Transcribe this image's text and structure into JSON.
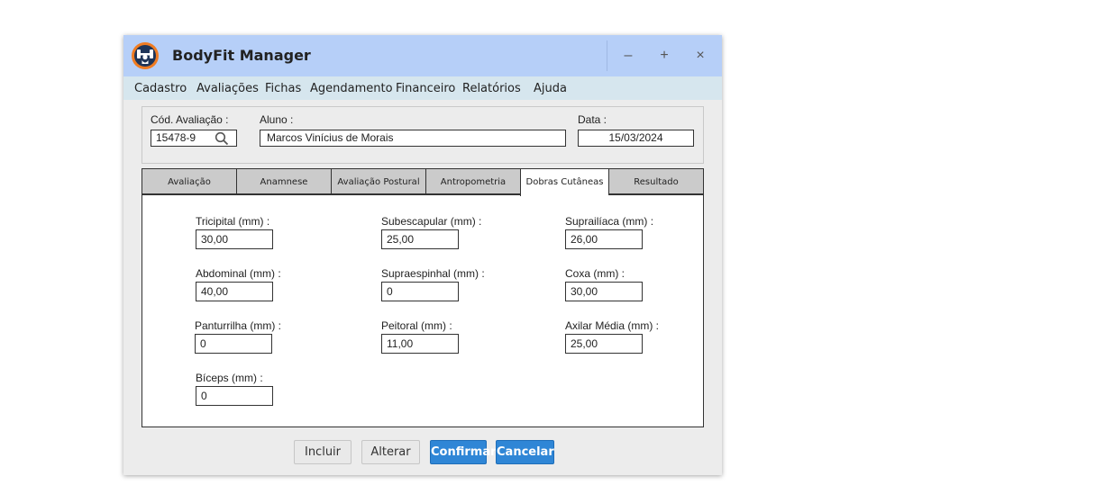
{
  "window": {
    "title": "BodyFit Manager",
    "controls": {
      "minimize": "–",
      "maximize": "+",
      "close": "×"
    }
  },
  "menu": [
    "Cadastro",
    "Avaliações",
    "Fichas",
    "Agendamento",
    "Financeiro",
    "Relatórios",
    "Ajuda"
  ],
  "header": {
    "cod_label": "Cód. Avaliação :",
    "cod_value": "15478-9",
    "aluno_label": "Aluno :",
    "aluno_value": "Marcos Vinícius de Morais",
    "data_label": "Data :",
    "data_value": "15/03/2024"
  },
  "tabs": [
    "Avaliação",
    "Anamnese",
    "Avaliação Postural",
    "Antropometria",
    "Dobras Cutâneas",
    "Resultado"
  ],
  "active_tab": "Dobras Cutâneas",
  "fields": [
    {
      "label": "Tricipital (mm) :",
      "value": "30,00"
    },
    {
      "label": "Subescapular (mm) :",
      "value": "25,00"
    },
    {
      "label": "Suprailíaca (mm) :",
      "value": "26,00"
    },
    {
      "label": "Abdominal (mm) :",
      "value": "40,00"
    },
    {
      "label": "Supraespinhal (mm) :",
      "value": "0"
    },
    {
      "label": "Coxa (mm) :",
      "value": "30,00"
    },
    {
      "label": "Panturrilha (mm) :",
      "value": "0"
    },
    {
      "label": "Peitoral (mm) :",
      "value": "11,00"
    },
    {
      "label": "Axilar Média (mm) :",
      "value": "25,00"
    },
    {
      "label": "Bíceps (mm) :",
      "value": "0"
    }
  ],
  "buttons": {
    "incluir": "Incluir",
    "alterar": "Alterar",
    "confirmar": "Confirmar",
    "cancelar": "Cancelar"
  },
  "colors": {
    "titlebar": "#b6cff8",
    "menubar": "#d6e6ee",
    "accent": "#2f86d6",
    "icon_orange": "#f07c22",
    "icon_navy": "#1f3558"
  }
}
